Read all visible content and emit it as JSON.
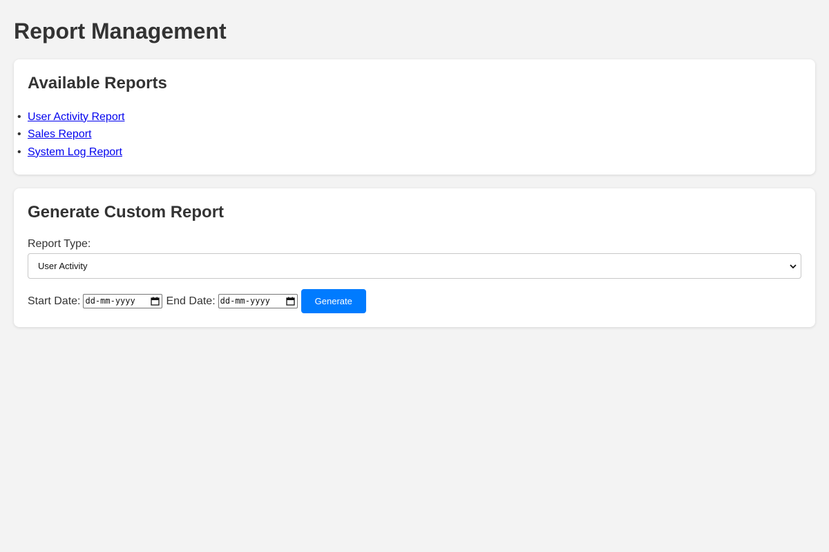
{
  "page": {
    "title": "Report Management"
  },
  "available_reports": {
    "title": "Available Reports",
    "items": [
      {
        "label": "User Activity Report"
      },
      {
        "label": "Sales Report"
      },
      {
        "label": "System Log Report"
      }
    ]
  },
  "custom_report": {
    "title": "Generate Custom Report",
    "report_type_label": "Report Type:",
    "report_type_value": "User Activity",
    "start_date_label": "Start Date:",
    "start_date_placeholder": "dd-mm-yyyy",
    "end_date_label": "End Date:",
    "end_date_placeholder": "dd-mm-yyyy",
    "generate_label": "Generate"
  },
  "colors": {
    "background": "#f3f3f3",
    "card": "#ffffff",
    "link": "#0000ee",
    "accent": "#007bff",
    "text": "#333333"
  },
  "icons": {
    "select_arrow": "chevron-down-icon",
    "date_picker": "calendar-icon"
  }
}
